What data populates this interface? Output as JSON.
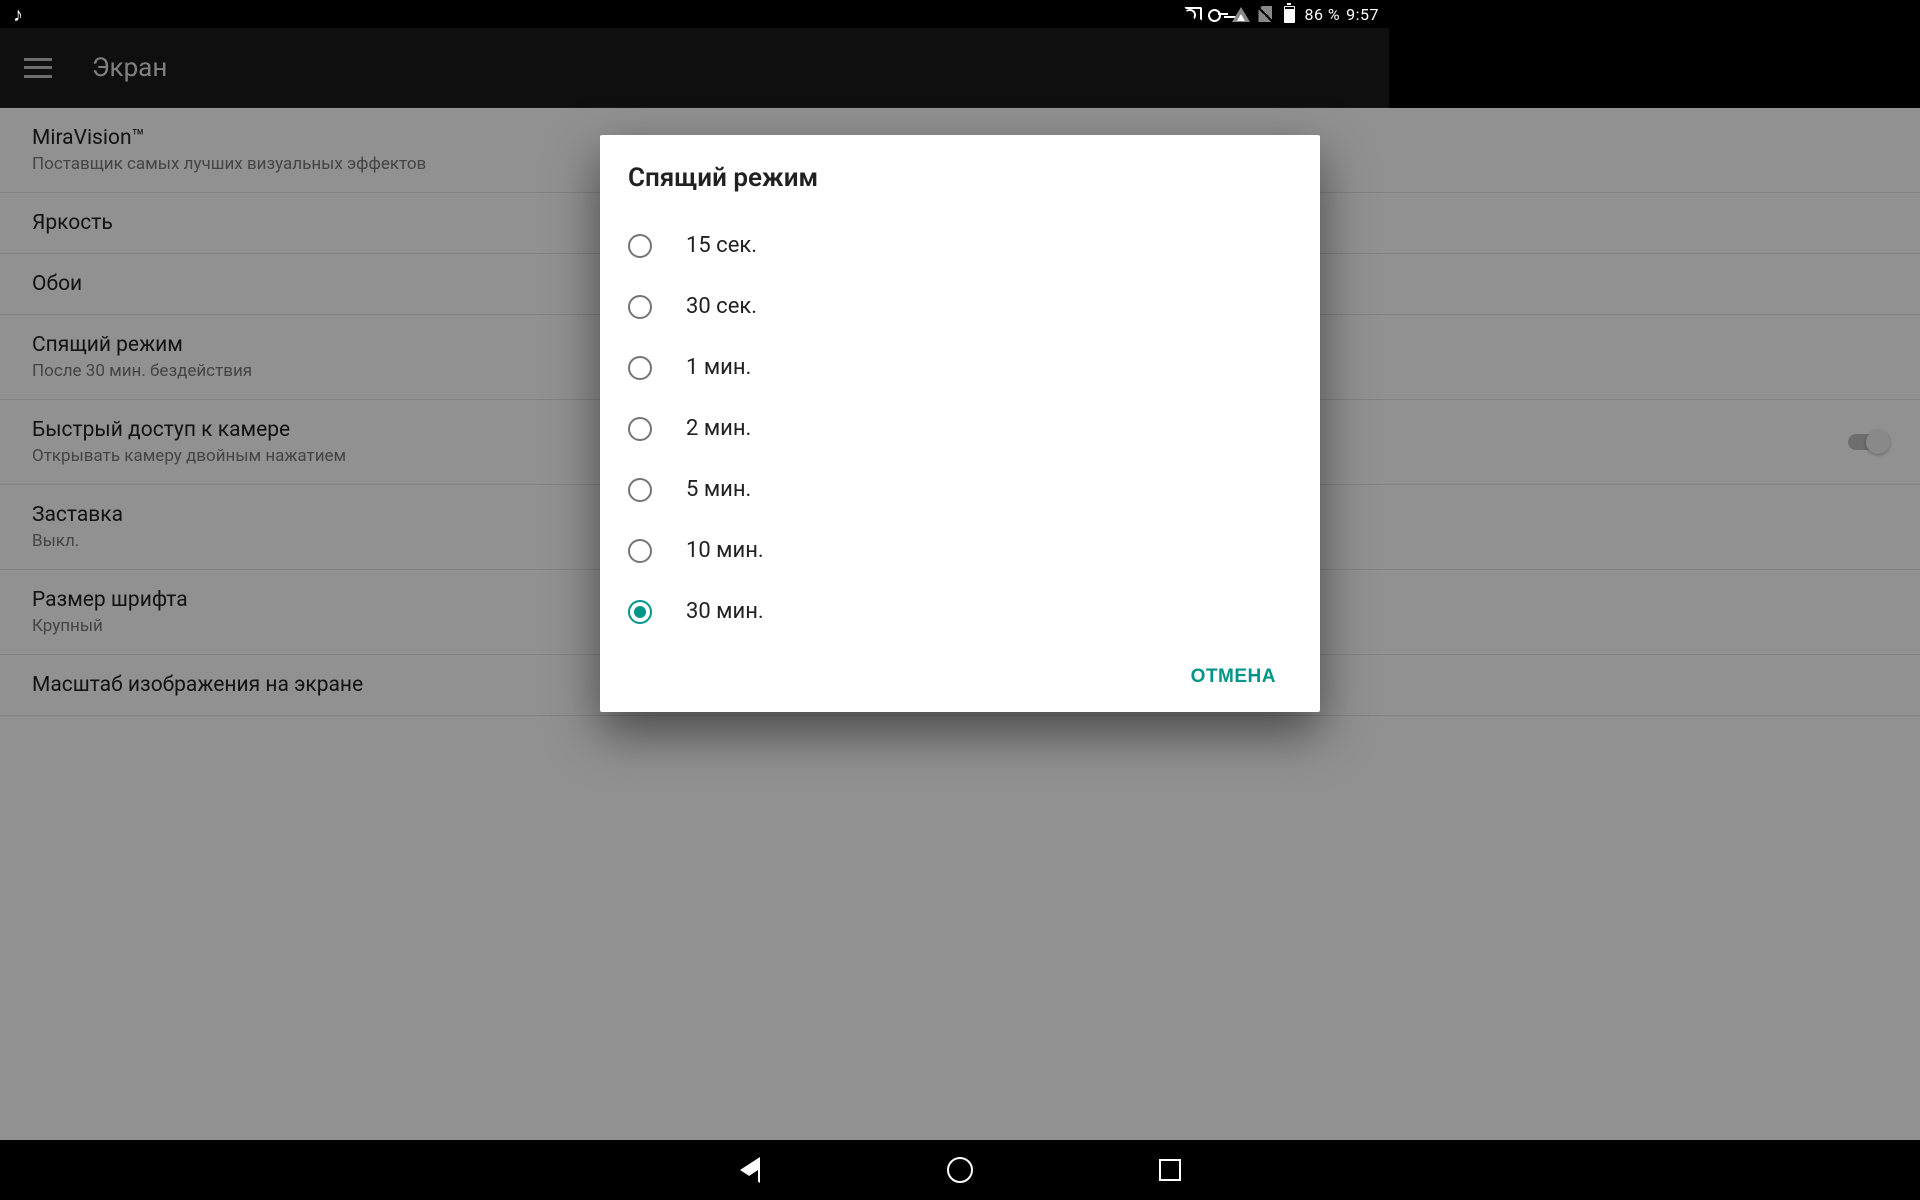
{
  "status": {
    "battery_pct": "86 %",
    "clock": "9:57"
  },
  "app_bar": {
    "title": "Экран"
  },
  "settings": [
    {
      "title": "MiraVision™",
      "sub": "Поставщик самых лучших визуальных эффектов"
    },
    {
      "title": "Яркость",
      "sub": ""
    },
    {
      "title": "Обои",
      "sub": ""
    },
    {
      "title": "Спящий режим",
      "sub": "После 30 мин. бездействия"
    },
    {
      "title": "Быстрый доступ к камере",
      "sub": "Открывать камеру двойным нажатием",
      "toggle": true
    },
    {
      "title": "Заставка",
      "sub": "Выкл."
    },
    {
      "title": "Размер шрифта",
      "sub": "Крупный"
    },
    {
      "title": "Масштаб изображения на экране",
      "sub": ""
    }
  ],
  "dialog": {
    "title": "Спящий режим",
    "options": [
      {
        "label": "15 сек.",
        "checked": false
      },
      {
        "label": "30 сек.",
        "checked": false
      },
      {
        "label": "1 мин.",
        "checked": false
      },
      {
        "label": "2 мин.",
        "checked": false
      },
      {
        "label": "5 мин.",
        "checked": false
      },
      {
        "label": "10 мин.",
        "checked": false
      },
      {
        "label": "30 мин.",
        "checked": true
      }
    ],
    "cancel": "ОТМЕНА"
  },
  "colors": {
    "accent": "#009688"
  }
}
